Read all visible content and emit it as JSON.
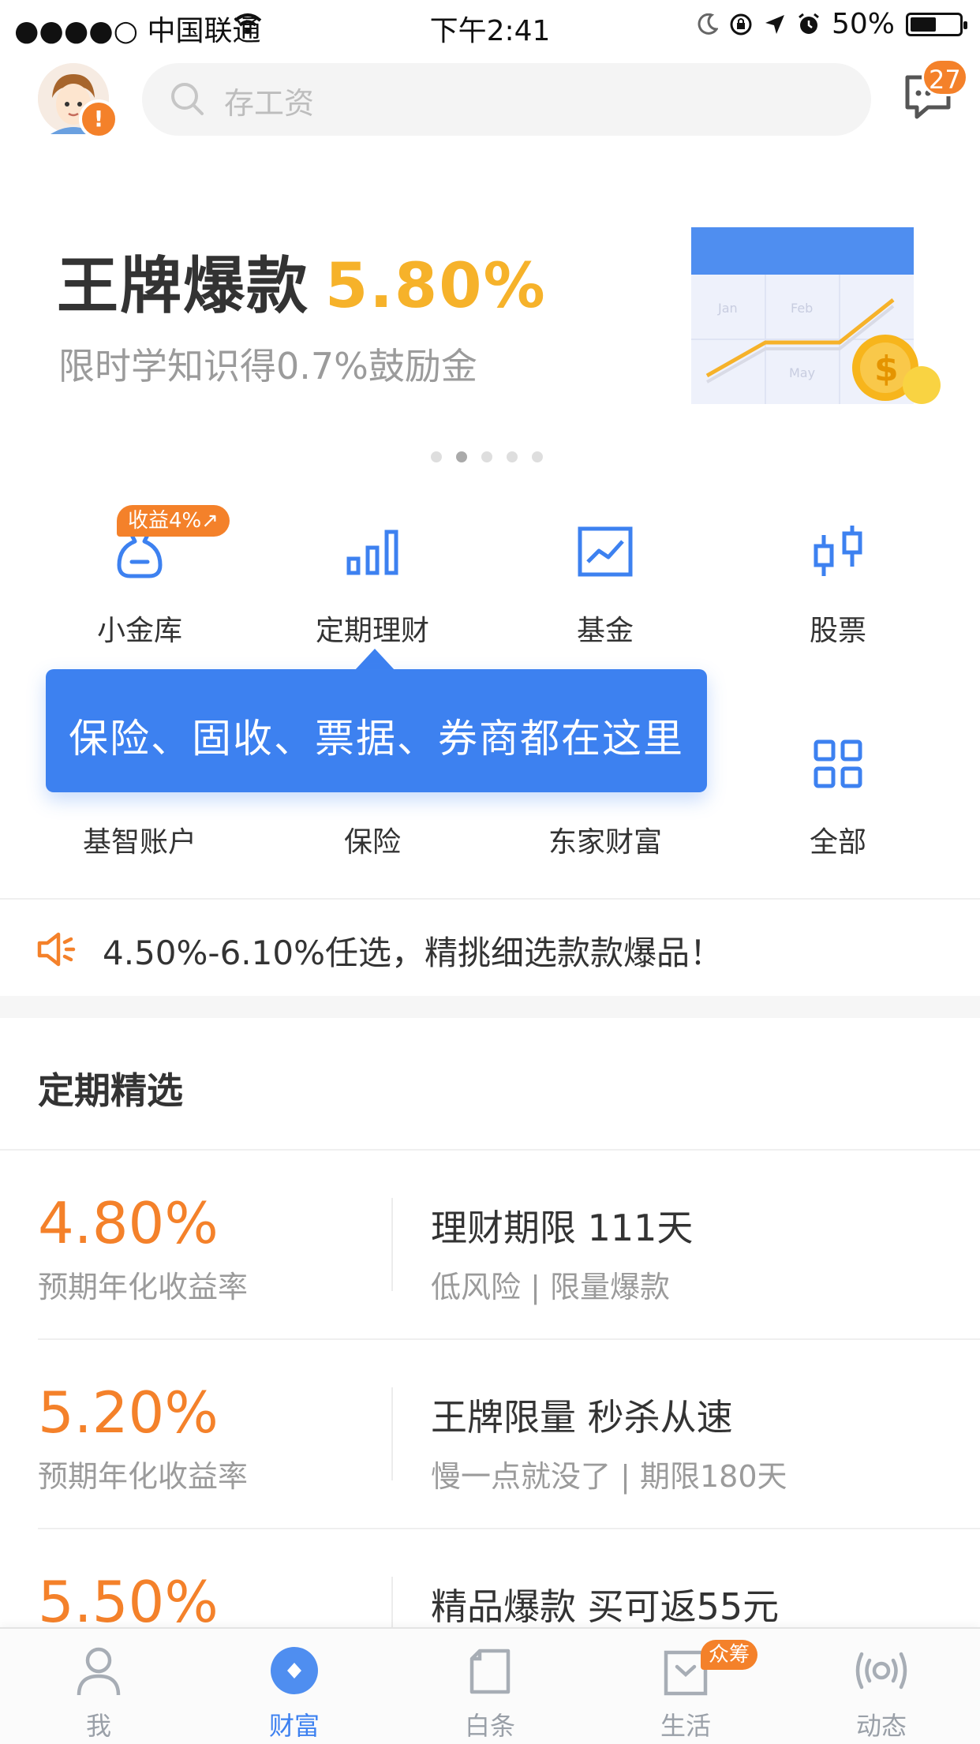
{
  "status_bar": {
    "carrier": "●●●●○ 中国联通",
    "time": "下午2:41",
    "battery": "50%"
  },
  "header": {
    "search_placeholder": "存工资",
    "message_count": "27",
    "avatar_alert": "!"
  },
  "banner": {
    "title": "王牌爆款",
    "rate": "5.80%",
    "subtitle": "限时学知识得0.7%鼓励金",
    "illustration_labels": [
      "Jan",
      "Feb",
      "May"
    ],
    "pager_total": 5,
    "pager_active": 2
  },
  "grid": {
    "tag": "收益4%↗",
    "row1": [
      {
        "label": "小金库",
        "icon": "pouch-icon"
      },
      {
        "label": "定期理财",
        "icon": "bar-chart-icon"
      },
      {
        "label": "基金",
        "icon": "trend-chart-icon"
      },
      {
        "label": "股票",
        "icon": "candlestick-icon"
      }
    ],
    "row2": [
      {
        "label": "基智账户",
        "icon": "account-icon"
      },
      {
        "label": "保险",
        "icon": "insurance-icon"
      },
      {
        "label": "东家财富",
        "icon": "wealth-icon"
      },
      {
        "label": "全部",
        "icon": "apps-grid-icon"
      }
    ]
  },
  "tooltip": {
    "text": "保险、固收、票据、券商都在这里"
  },
  "notice": {
    "text": "4.50%-6.10%任选，精挑细选款款爆品！"
  },
  "section": {
    "title": "定期精选"
  },
  "products": [
    {
      "rate": "4.80%",
      "rate_label": "预期年化收益率",
      "title": "理财期限 111天",
      "subtitle": "低风险 | 限量爆款"
    },
    {
      "rate": "5.20%",
      "rate_label": "预期年化收益率",
      "title": "王牌限量 秒杀从速",
      "subtitle": "慢一点就没了 | 期限180天"
    },
    {
      "rate": "5.50%",
      "rate_label": "",
      "title": "精品爆款 买可返55元",
      "subtitle": ""
    }
  ],
  "tabbar": {
    "items": [
      {
        "label": "我",
        "icon": "person-icon"
      },
      {
        "label": "财富",
        "icon": "diamond-coin-icon"
      },
      {
        "label": "白条",
        "icon": "card-icon"
      },
      {
        "label": "生活",
        "icon": "shopping-bag-icon"
      },
      {
        "label": "动态",
        "icon": "broadcast-icon"
      }
    ],
    "active_index": 1,
    "life_badge": "众筹"
  },
  "colors": {
    "accent_blue": "#3d81f0",
    "accent_orange": "#f4812a",
    "banner_yellow": "#f6b22a"
  }
}
